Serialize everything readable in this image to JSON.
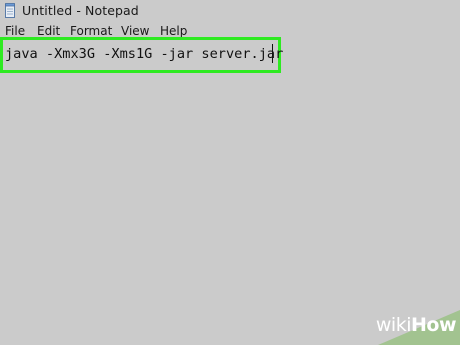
{
  "window": {
    "title": "Untitled - Notepad"
  },
  "menu": {
    "items": [
      "File",
      "Edit",
      "Format",
      "View",
      "Help"
    ]
  },
  "editor": {
    "lines": [
      "java -Xmx3G -Xms1G -jar server.jar"
    ],
    "highlight_color": "#2eea21",
    "background_color": "#cbcbcb"
  },
  "watermark": {
    "text_prefix": "wiki",
    "text_suffix": "How"
  },
  "icons": {
    "app": "notepad-icon"
  }
}
